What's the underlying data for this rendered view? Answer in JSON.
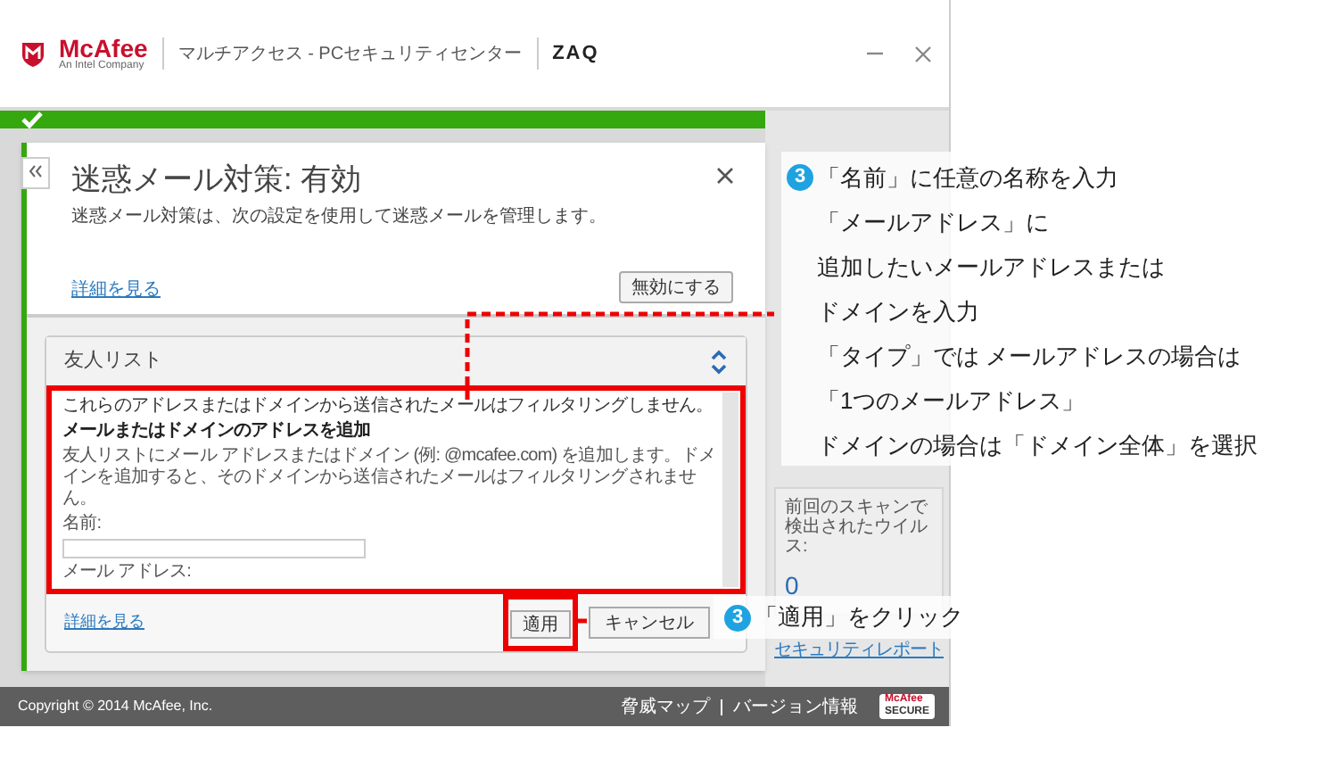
{
  "header": {
    "brand": "McAfee",
    "brand_sub": "An Intel Company",
    "product": "マルチアクセス - PCセキュリティセンター",
    "partner": "ZAQ"
  },
  "status_bar": {
    "protected": true
  },
  "panel": {
    "title": "迷惑メール対策: 有効",
    "description": "迷惑メール対策は、次の設定を使用して迷惑メールを管理します。",
    "link": "詳細を見る",
    "button": "無効にする"
  },
  "friends": {
    "title": "友人リスト",
    "expanded": true,
    "intro": "これらのアドレスまたはドメインから送信されたメールはフィルタリングしません。",
    "heading": "メールまたはドメインのアドレスを追加",
    "body": "友人リストにメール アドレスまたはドメイン (例: @mcafee.com) を追加します。ドメインを追加すると、そのドメインから送信されたメールはフィルタリングされません。",
    "name_label": "名前:",
    "email_label": "メール アドレス:",
    "link": "詳細を見る",
    "buttons": [
      "適用",
      "キャンセル"
    ]
  },
  "sidebar": {
    "scan_label": "前回のスキャンで検出されたウイルス:",
    "scan_count": "0",
    "report_link": "セキュリティレポート"
  },
  "footer": {
    "copyright": "Copyright © 2014 McAfee, Inc.",
    "links": [
      "脅威マップ",
      "バージョン情報"
    ],
    "badge_top": "McAfee",
    "badge_bottom": "SECURE"
  },
  "annotations": [
    {
      "step": "3",
      "lines": [
        "「名前」に任意の名称を入力",
        "「メールアドレス」に",
        "追加したいメールアドレスまたは",
        "ドメインを入力",
        "「タイプ」では メールアドレスの場合は",
        "「1つのメールアドレス」",
        "ドメインの場合は「ドメイン全体」を選択"
      ]
    },
    {
      "step": "3",
      "lines": [
        "「適用」をクリック"
      ]
    }
  ]
}
